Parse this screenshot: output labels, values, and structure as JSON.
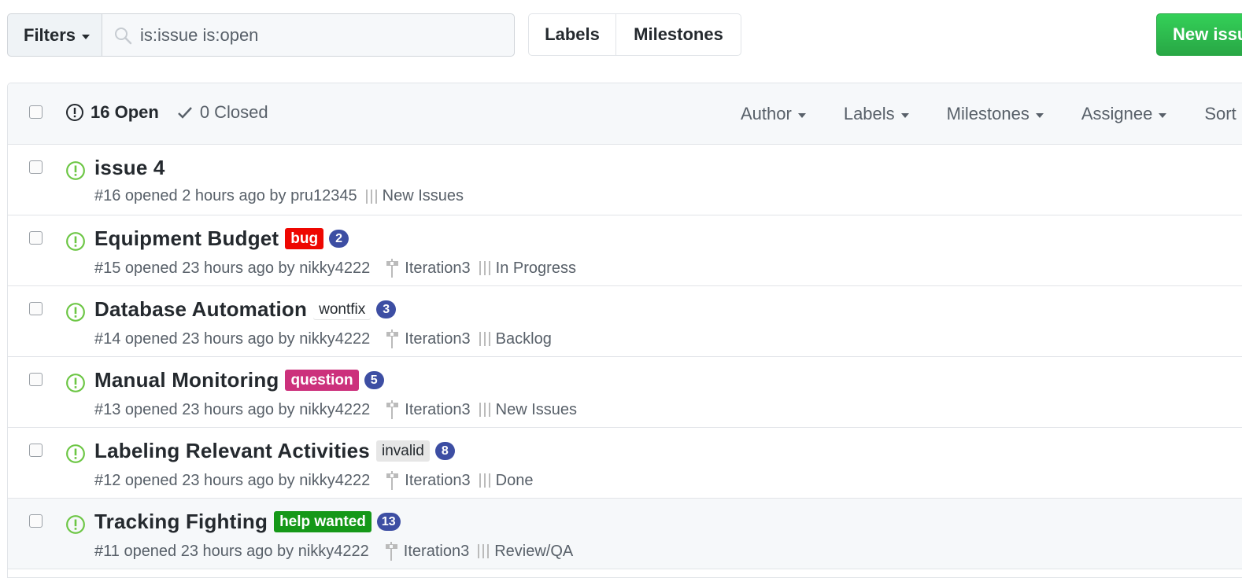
{
  "toolbar": {
    "filters_label": "Filters",
    "search_value": "is:issue is:open",
    "labels_label": "Labels",
    "milestones_label": "Milestones",
    "new_issue_label": "New issue"
  },
  "header": {
    "open_label": "16 Open",
    "closed_label": "0 Closed",
    "filters": [
      "Author",
      "Labels",
      "Milestones",
      "Assignee",
      "Sort"
    ]
  },
  "colors": {
    "open_icon": "#6cc644",
    "bug": "#ee0701",
    "wontfix": "#ffffff",
    "question": "#cc317c",
    "invalid": "#e6e6e6",
    "help_wanted": "#159818",
    "count_badge": "#3d4ea3",
    "new_issue": "#28a745"
  },
  "issues": [
    {
      "title": "issue 4",
      "label": "",
      "count": "",
      "meta": "#16 opened 2 hours ago by pru12345",
      "milestone": "",
      "project": "New Issues"
    },
    {
      "title": "Equipment Budget",
      "label": "bug",
      "count": "2",
      "meta": "#15 opened 23 hours ago by nikky4222",
      "milestone": "Iteration3",
      "project": "In Progress"
    },
    {
      "title": "Database Automation",
      "label": "wontfix",
      "count": "3",
      "meta": "#14 opened 23 hours ago by nikky4222",
      "milestone": "Iteration3",
      "project": "Backlog"
    },
    {
      "title": "Manual Monitoring",
      "label": "question",
      "count": "5",
      "meta": "#13 opened 23 hours ago by nikky4222",
      "milestone": "Iteration3",
      "project": "New Issues"
    },
    {
      "title": "Labeling Relevant Activities",
      "label": "invalid",
      "count": "8",
      "meta": "#12 opened 23 hours ago by nikky4222",
      "milestone": "Iteration3",
      "project": "Done"
    },
    {
      "title": "Tracking Fighting",
      "label": "help wanted",
      "count": "13",
      "meta": "#11 opened 23 hours ago by nikky4222",
      "milestone": "Iteration3",
      "project": "Review/QA"
    }
  ]
}
